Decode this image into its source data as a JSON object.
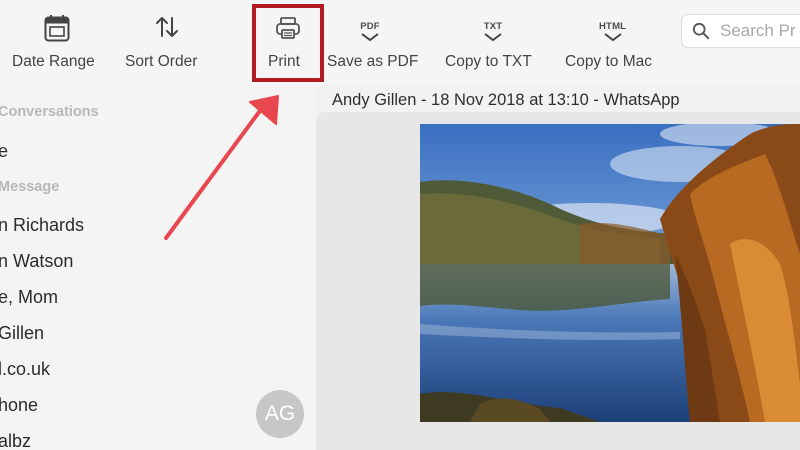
{
  "toolbar": {
    "date_range_label": "Date Range",
    "sort_order_label": "Sort Order",
    "print_label": "Print",
    "save_pdf_label": "Save as PDF",
    "save_pdf_tag": "PDF",
    "copy_txt_label": "Copy to TXT",
    "copy_txt_tag": "TXT",
    "copy_mac_label": "Copy to Mac",
    "copy_mac_tag": "HTML"
  },
  "search": {
    "placeholder": "Search Pr"
  },
  "sidebar": {
    "conversations_header": "Conversations",
    "first_item": "e",
    "message_header": "Message",
    "items": [
      {
        "label": "n Richards"
      },
      {
        "label": "n Watson"
      },
      {
        "label": "e, Mom"
      },
      {
        "label": "Gillen"
      },
      {
        "label": "l.co.uk"
      },
      {
        "label": "hone"
      },
      {
        "label": "albz"
      }
    ],
    "avatar_initials": "AG"
  },
  "conversation": {
    "title": "Andy Gillen - 18 Nov 2018 at 13:10 - WhatsApp"
  },
  "colors": {
    "highlight": "#b01c22",
    "arrow": "#e8474f"
  }
}
